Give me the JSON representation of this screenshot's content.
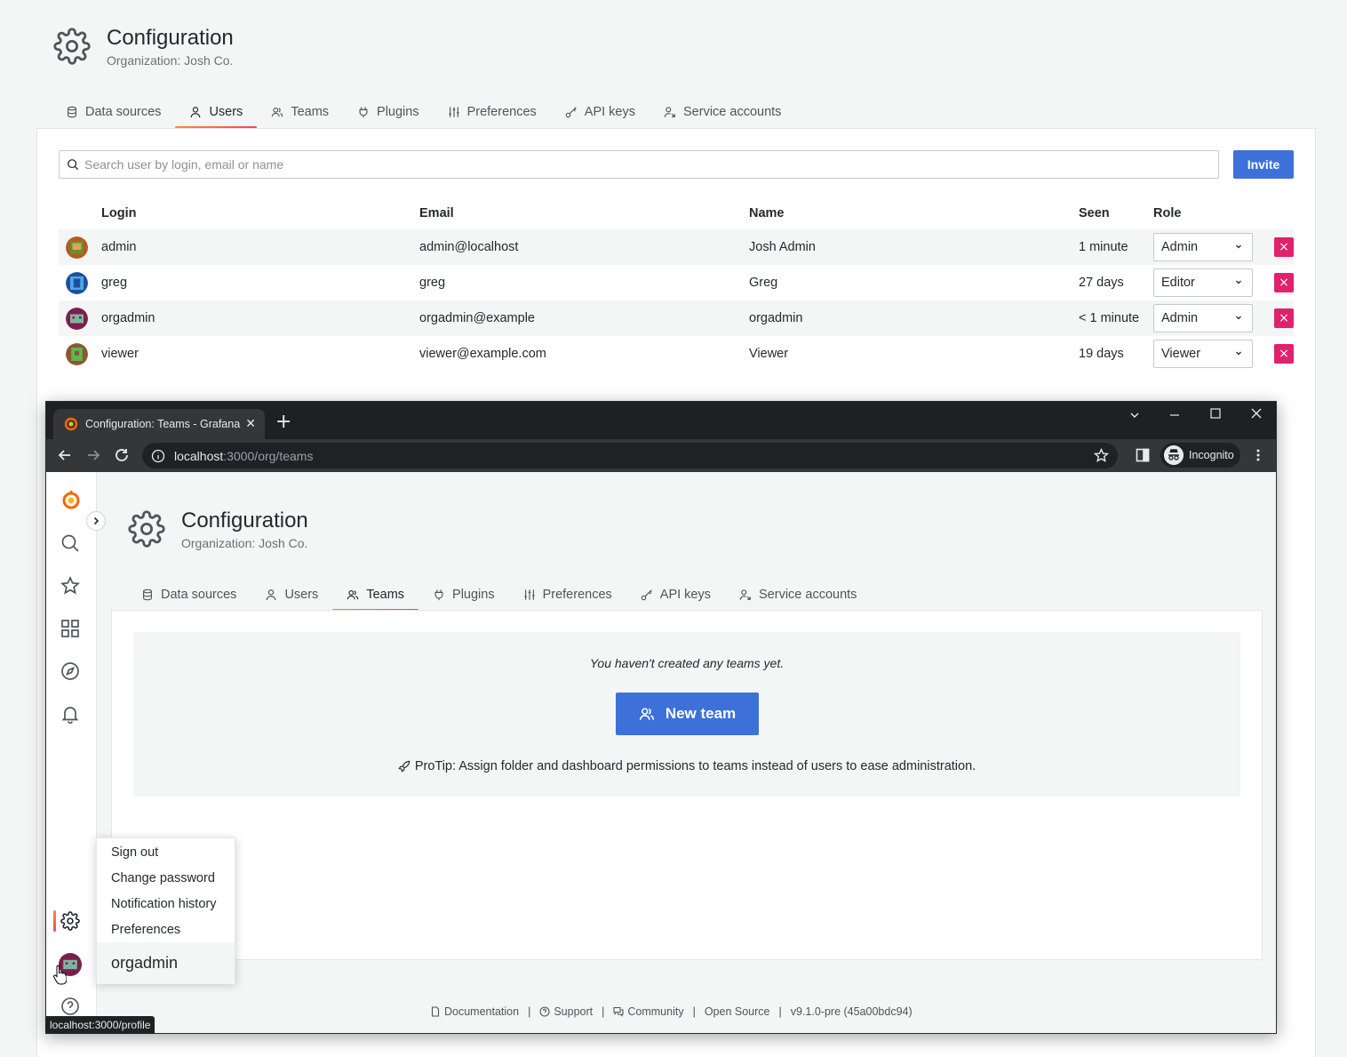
{
  "page": {
    "title": "Configuration",
    "subtitle": "Organization: Josh Co.",
    "tabs": [
      {
        "label": "Data sources",
        "icon": "database-icon"
      },
      {
        "label": "Users",
        "icon": "user-icon"
      },
      {
        "label": "Teams",
        "icon": "users-icon"
      },
      {
        "label": "Plugins",
        "icon": "plug-icon"
      },
      {
        "label": "Preferences",
        "icon": "sliders-icon"
      },
      {
        "label": "API keys",
        "icon": "key-icon"
      },
      {
        "label": "Service accounts",
        "icon": "user-arrows-icon"
      }
    ],
    "active_tab": "Users",
    "search_placeholder": "Search user by login, email or name",
    "invite_label": "Invite",
    "table": {
      "columns": [
        "Login",
        "Email",
        "Name",
        "Seen",
        "Role"
      ],
      "rows": [
        {
          "login": "admin",
          "email": "admin@localhost",
          "name": "Josh Admin",
          "seen": "1 minute",
          "role": "Admin"
        },
        {
          "login": "greg",
          "email": "greg",
          "name": "Greg",
          "seen": "27 days",
          "role": "Editor"
        },
        {
          "login": "orgadmin",
          "email": "orgadmin@example",
          "name": "orgadmin",
          "seen": "< 1 minute",
          "role": "Admin"
        },
        {
          "login": "viewer",
          "email": "viewer@example.com",
          "name": "Viewer",
          "seen": "19 days",
          "role": "Viewer"
        }
      ],
      "delete_symbol": "×"
    }
  },
  "browser": {
    "tab_title": "Configuration: Teams - Grafana",
    "url_host": "localhost",
    "url_path": ":3000/org/teams",
    "incognito_label": "Incognito",
    "status_url": "localhost:3000/profile"
  },
  "inner": {
    "title": "Configuration",
    "subtitle": "Organization: Josh Co.",
    "active_tab": "Teams",
    "empty_message": "You haven't created any teams yet.",
    "new_team_label": "New team",
    "protip": "ProTip: Assign folder and dashboard permissions to teams instead of users to ease administration.",
    "footer": [
      "Documentation",
      "Support",
      "Community",
      "Open Source",
      "v9.1.0-pre (45a00bdc94)"
    ],
    "footer_sep": "|",
    "user_menu": {
      "items": [
        "Sign out",
        "Change password",
        "Notification history",
        "Preferences"
      ],
      "username": "orgadmin"
    }
  },
  "colors": {
    "primary": "#3d71d9",
    "danger": "#e0226e",
    "accent_gradient_start": "#ff8833",
    "accent_gradient_end": "#f2495c"
  }
}
